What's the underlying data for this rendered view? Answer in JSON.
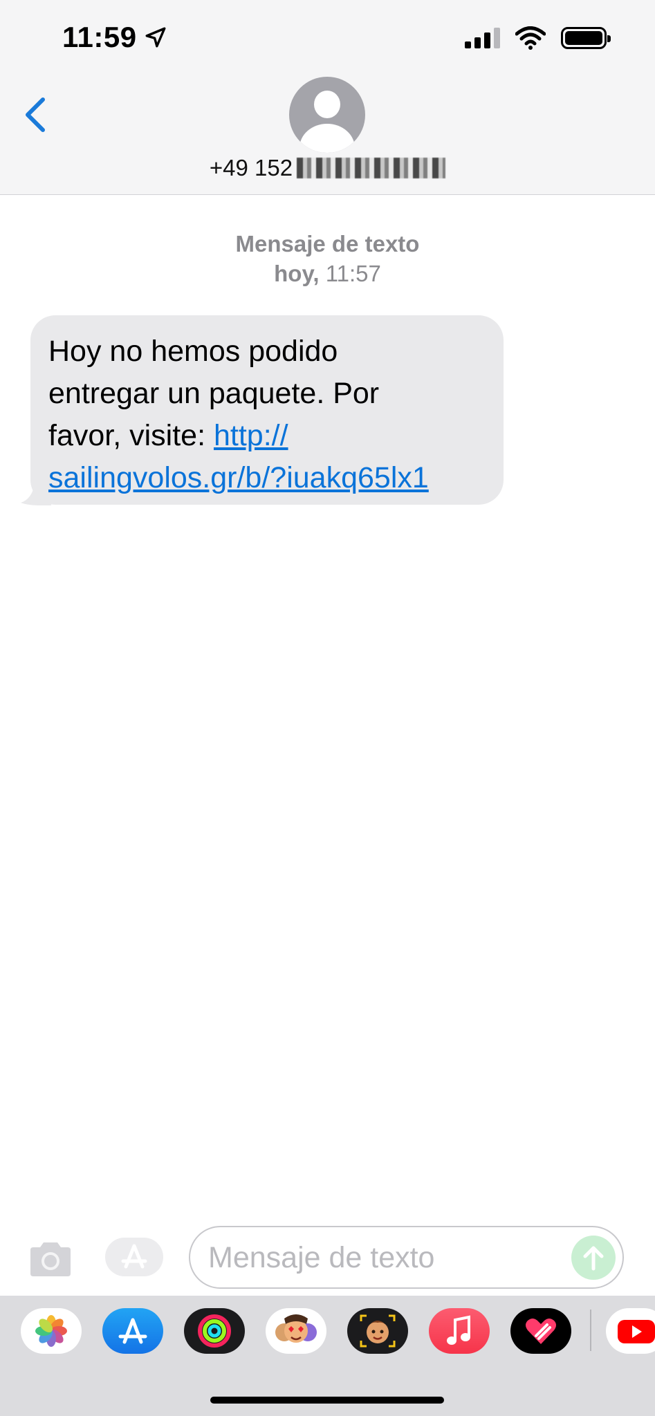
{
  "status_bar": {
    "time": "11:59"
  },
  "header": {
    "back_label": "",
    "contact_number": "+49 152"
  },
  "conversation": {
    "service_label": "Mensaje de texto",
    "day": "hoy,",
    "time": "11:57",
    "message": {
      "text_line1": "Hoy no hemos podido",
      "text_line2": "entregar un paquete. Por",
      "text_line3": "favor, visite: ",
      "link_part1": "http://",
      "link_part2": "sailingvolos.gr/b/?iuakq65lx1"
    }
  },
  "composer": {
    "placeholder": "Mensaje de texto"
  },
  "app_drawer": {
    "apps": [
      "photos-icon",
      "app-store-icon",
      "activity-icon",
      "memoji-stickers-icon",
      "memoji-icon",
      "music-icon",
      "digital-touch-icon",
      "youtube-icon"
    ]
  },
  "colors": {
    "link": "#0a73d9",
    "bubble": "#e9e9eb",
    "accent": "#1a7ad9"
  }
}
